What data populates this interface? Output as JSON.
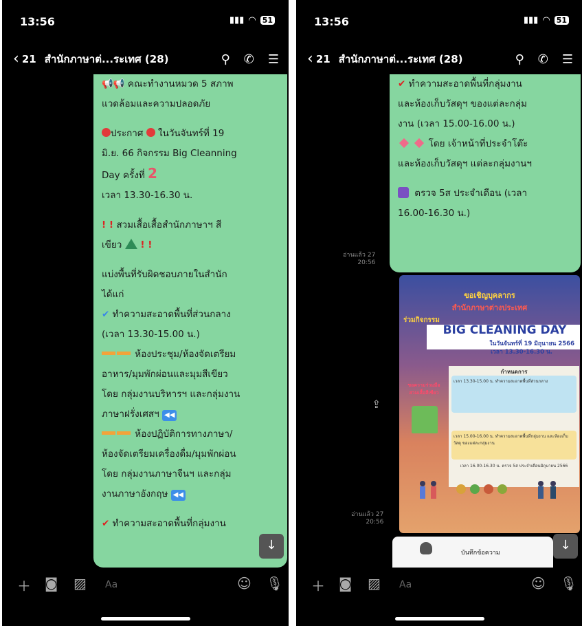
{
  "left": {
    "status": {
      "time": "13:56",
      "battery": "51"
    },
    "header": {
      "back_count": "21",
      "title": "สำนักภาษาต่...ระเทศ (28)"
    },
    "bubble": {
      "l1": "คณะทำงานหมวด 5 สภาพ",
      "l2": "แวดล้อมและความปลอดภัย",
      "l3": "ประกาศ",
      "l3b": "ในวันจันทร์ที่ 19",
      "l4": "มิ.ย. 66 กิจกรรม Big Cleanning",
      "l5": "Day ครั้งที่",
      "l5b": "2",
      "l6": "เวลา 13.30-16.30 น.",
      "l7": "สวมเสื้อเสื้อสำนักภาษาฯ สี",
      "l8": "เขียว",
      "l9": "แบ่งพื้นที่รับผิดชอบภายในสำนัก",
      "l10": "ได้แก่",
      "l11": "ทำความสะอาดพื้นที่ส่วนกลาง",
      "l12": "(เวลา 13.30-15.00 น.)",
      "l13": "ห้องประชุม/ห้องจัดเตรียม",
      "l14": "อาหาร/มุมพักผ่อนและมุมสีเขียว",
      "l15": "โดย กลุ่มงานบริหารฯ และกลุ่มงาน",
      "l16": "ภาษาฝรั่งเศสฯ",
      "l17": "ห้องปฏิบัติการทางภาษา/",
      "l18": "ห้องจัดเตรียมเครื่องดื่ม/มุมพักผ่อน",
      "l19": "โดย กลุ่มงานภาษาจีนฯ และกลุ่ม",
      "l20": "งานภาษาอังกฤษ",
      "l21": "ทำความสะอาดพื้นที่กลุ่มงาน"
    },
    "input_placeholder": "Aa"
  },
  "right": {
    "status": {
      "time": "13:56",
      "battery": "51"
    },
    "header": {
      "back_count": "21",
      "title": "สำนักภาษาต่...ระเทศ (28)"
    },
    "bubble": {
      "l1": "ทำความสะอาดพื้นที่กลุ่มงาน",
      "l2": "และห้องเก็บวัสดุฯ ของแต่ละกลุ่ม",
      "l3": "งาน (เวลา 15.00-16.00 น.)",
      "l4": "โดย เจ้าหน้าที่ประจำโต๊ะ",
      "l5": "และห้องเก็บวัสดุฯ แต่ละกลุ่มงานฯ",
      "l6": "ตรวจ 5ส ประจำเดือน (เวลา",
      "l7": "16.00-16.30 น.)"
    },
    "read1": {
      "label": "อ่านแล้ว 27",
      "time": "20:56"
    },
    "read2": {
      "label": "อ่านแล้ว 27",
      "time": "20:56"
    },
    "poster": {
      "line1": "ขอเชิญบุคลากร",
      "line2": "สำนักภาษาต่างประเทศ",
      "line3": "ร่วมกิจกรรม",
      "title": "BIG CLEANING DAY",
      "date": "ในวันจันทร์ที่ 19 มิถุนายน 2566",
      "time": "เวลา 13.30-16.30 น.",
      "schedule": "กำหนดการ",
      "s1": "เวลา 13.30-15.00 น. ทำความสะอาดพื้นที่ส่วนกลาง",
      "s2": "เวลา 15.00-16.00 น. ทำความสะอาดพื้นที่กลุ่มงาน และห้องเก็บวัสดุ ของแต่ละกลุ่มงาน",
      "s3": "เวลา 16.00-16.30 น. ตรวจ 5ส ประจำเดือนมิถุนายน 2566",
      "side": "ขอความร่วมมือ สวมเสื้อสีเขียว"
    },
    "doc_title": "บันทึกข้อความ",
    "input_placeholder": "Aa"
  }
}
